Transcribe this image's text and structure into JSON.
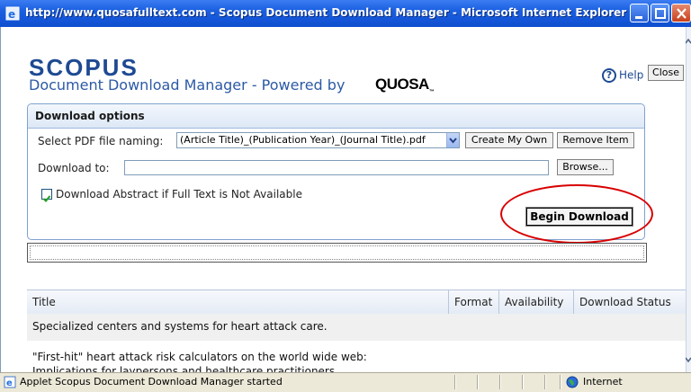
{
  "window": {
    "title": "http://www.quosafulltext.com - Scopus Document Download Manager - Microsoft Internet Explorer"
  },
  "header": {
    "logo": "SCOPUS",
    "subtitle": "Document Download Manager - Powered by",
    "powered_brand": "QUOSA",
    "help_label": "Help",
    "close_label": "Close"
  },
  "download_options": {
    "heading": "Download options",
    "naming_label": "Select PDF file naming:",
    "naming_value": "(Article Title)_(Publication Year)_(Journal Title).pdf",
    "create_label": "Create My Own",
    "remove_label": "Remove Item",
    "download_to_label": "Download to:",
    "download_to_value": "",
    "browse_label": "Browse...",
    "abstract_checkbox_label": "Download Abstract if Full Text is Not Available",
    "abstract_checked": true,
    "begin_label": "Begin Download"
  },
  "table": {
    "columns": [
      "Title",
      "Format",
      "Availability",
      "Download Status"
    ],
    "rows": [
      {
        "title": "Specialized centers and systems for heart attack care."
      },
      {
        "title": "\"First-hit\" heart attack risk calculators on the world wide web:",
        "title_line2": "Implications for laypersons and healthcare practitioners"
      }
    ]
  },
  "statusbar": {
    "text": "Applet Scopus Document Download Manager started",
    "zone": "Internet"
  },
  "colors": {
    "titlebar": "#1a5fe0",
    "brand_blue": "#1e4a93",
    "highlight_circle": "#d80000"
  }
}
